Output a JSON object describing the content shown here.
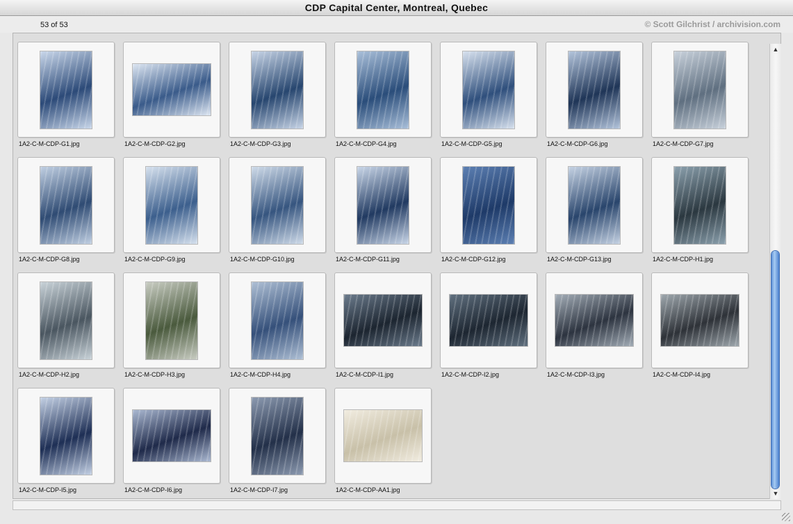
{
  "window": {
    "title": "CDP Capital Center, Montreal, Quebec"
  },
  "header": {
    "count": "53 of 53",
    "credit": "© Scott Gilchrist / archivision.com"
  },
  "colors": {
    "scroll_accent": "#4a80cf",
    "credit_text": "#9a9a9a"
  },
  "thumbnails": [
    "1A2-C-M-CDP-G1.jpg",
    "1A2-C-M-CDP-G2.jpg",
    "1A2-C-M-CDP-G3.jpg",
    "1A2-C-M-CDP-G4.jpg",
    "1A2-C-M-CDP-G5.jpg",
    "1A2-C-M-CDP-G6.jpg",
    "1A2-C-M-CDP-G7.jpg",
    "1A2-C-M-CDP-G8.jpg",
    "1A2-C-M-CDP-G9.jpg",
    "1A2-C-M-CDP-G10.jpg",
    "1A2-C-M-CDP-G11.jpg",
    "1A2-C-M-CDP-G12.jpg",
    "1A2-C-M-CDP-G13.jpg",
    "1A2-C-M-CDP-H1.jpg",
    "1A2-C-M-CDP-H2.jpg",
    "1A2-C-M-CDP-H3.jpg",
    "1A2-C-M-CDP-H4.jpg",
    "1A2-C-M-CDP-I1.jpg",
    "1A2-C-M-CDP-I2.jpg",
    "1A2-C-M-CDP-I3.jpg",
    "1A2-C-M-CDP-I4.jpg",
    "1A2-C-M-CDP-I5.jpg",
    "1A2-C-M-CDP-I6.jpg",
    "1A2-C-M-CDP-I7.jpg",
    "1A2-C-M-CDP-AA1.jpg"
  ],
  "scrollbar": {
    "up_icon": "scroll-up-arrow-icon",
    "down_icon": "scroll-down-arrow-icon"
  }
}
